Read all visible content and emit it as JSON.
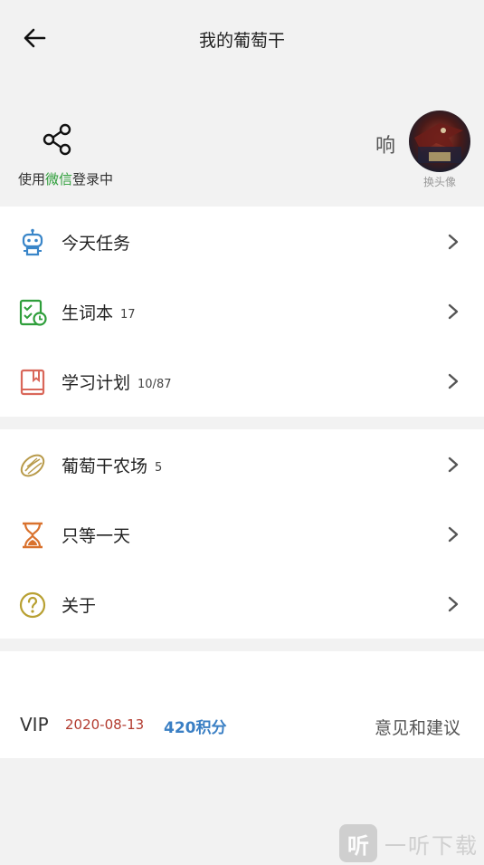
{
  "header": {
    "title": "我的葡萄干",
    "back_icon": "arrow-left-icon"
  },
  "profile": {
    "share_icon": "share-icon",
    "login_prefix": "使用",
    "login_platform": "微信",
    "login_suffix": "登录中",
    "nickname": "响",
    "change_avatar_label": "换头像",
    "login_platform_color": "#2e9e3a"
  },
  "menu_group_1": [
    {
      "icon": "robot-icon",
      "label": "今天任务",
      "count": ""
    },
    {
      "icon": "vocabulary-book-icon",
      "label": "生词本",
      "count": "17"
    },
    {
      "icon": "study-plan-book-icon",
      "label": "学习计划",
      "count": "10/87"
    }
  ],
  "menu_group_2": [
    {
      "icon": "raisin-icon",
      "label": "葡萄干农场",
      "count": "5"
    },
    {
      "icon": "hourglass-icon",
      "label": "只等一天",
      "count": ""
    },
    {
      "icon": "question-icon",
      "label": "关于",
      "count": ""
    }
  ],
  "footer": {
    "vip_label": "VIP",
    "vip_expiry": "2020-08-13",
    "points": "420积分",
    "feedback_label": "意见和建议",
    "vip_date_color": "#b23a2e",
    "points_color": "#3a7fc4"
  },
  "watermark": {
    "logo_char": "听",
    "text": "一听下载"
  }
}
